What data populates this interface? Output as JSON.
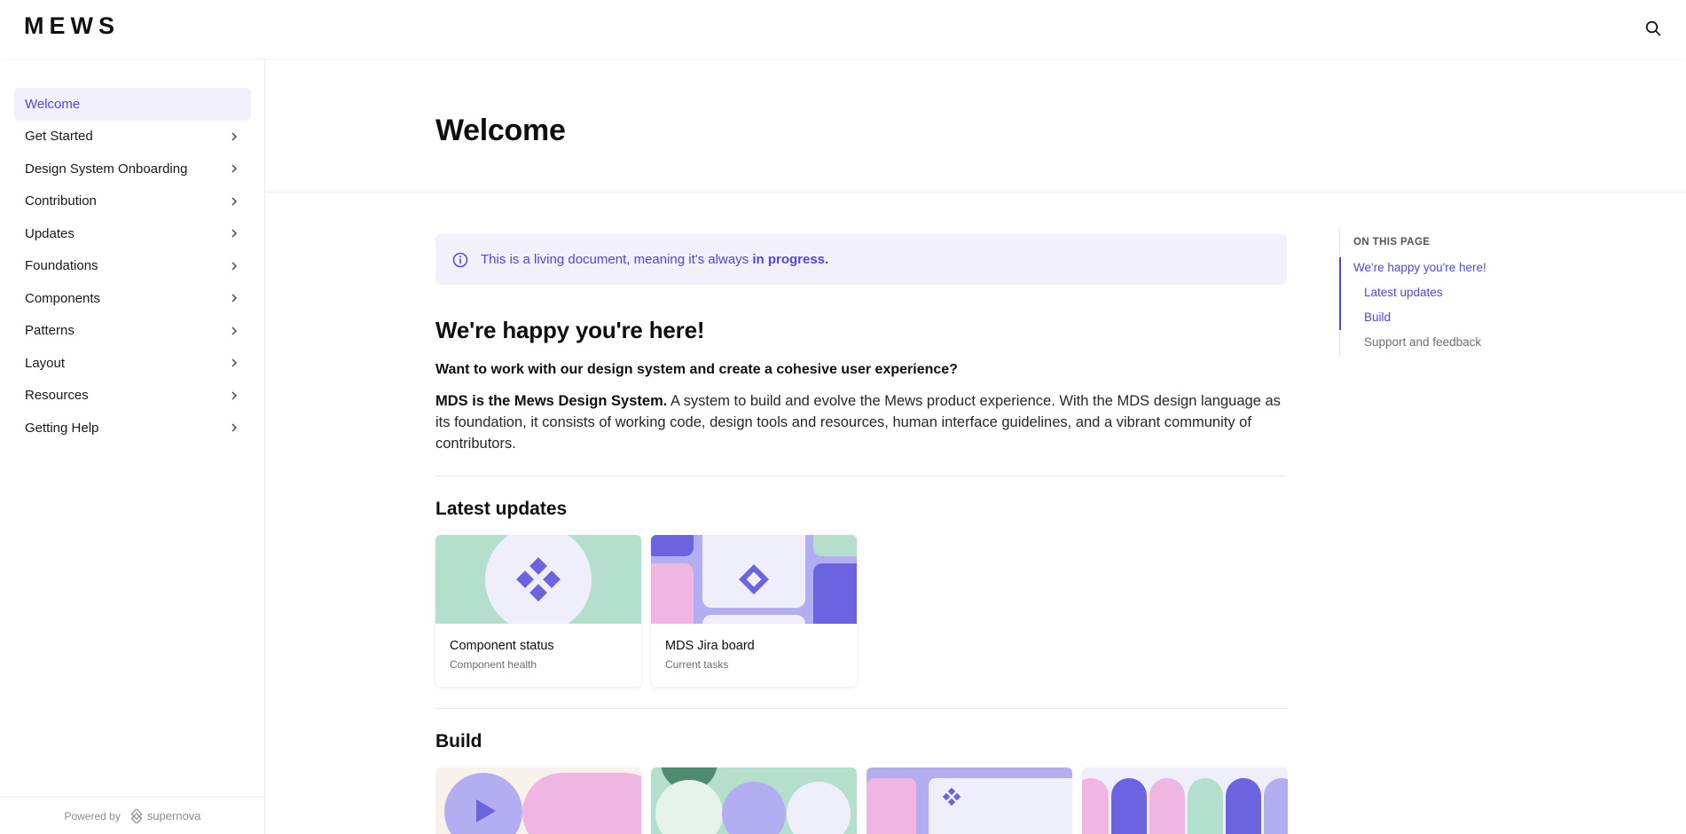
{
  "brand": {
    "logo_text": "MEWS"
  },
  "header": {
    "search_icon": "search-icon"
  },
  "sidebar": {
    "items": [
      {
        "label": "Welcome",
        "active": true
      },
      {
        "label": "Get Started"
      },
      {
        "label": "Design System Onboarding"
      },
      {
        "label": "Contribution"
      },
      {
        "label": "Updates"
      },
      {
        "label": "Foundations"
      },
      {
        "label": "Components"
      },
      {
        "label": "Patterns"
      },
      {
        "label": "Layout"
      },
      {
        "label": "Resources"
      },
      {
        "label": "Getting Help"
      }
    ],
    "powered_by": "Powered by",
    "powered_brand": "supernova"
  },
  "page": {
    "title": "Welcome"
  },
  "callout": {
    "text": "This is a living document, meaning it's always ",
    "emphasis": "in progress.",
    "icon": "info-icon"
  },
  "intro": {
    "heading": "We're happy you're here!",
    "lead": "Want to work with our design system and create a cohesive user experience?",
    "para_bold": "MDS is the Mews Design System.",
    "para_rest": " A system to build and evolve the Mews product experience. With the MDS design language as its foundation, it consists of working code, design tools and resources, human interface guidelines, and a vibrant community of contributors."
  },
  "latest": {
    "heading": "Latest updates",
    "cards": [
      {
        "title": "Component status",
        "subtitle": "Component health"
      },
      {
        "title": "MDS Jira board",
        "subtitle": "Current tasks"
      }
    ]
  },
  "build": {
    "heading": "Build"
  },
  "toc": {
    "heading": "ON THIS PAGE",
    "items": [
      {
        "label": "We're happy you're here!"
      },
      {
        "label": "Latest updates"
      },
      {
        "label": "Build"
      },
      {
        "label": "Support and feedback"
      }
    ]
  },
  "colors": {
    "accent": "#4f46e5",
    "purple": "#6c63e0",
    "lavender": "#b3adf2",
    "mint": "#b4dfcc",
    "pink": "#efb6e3",
    "dark_green": "#4e8b6f"
  }
}
